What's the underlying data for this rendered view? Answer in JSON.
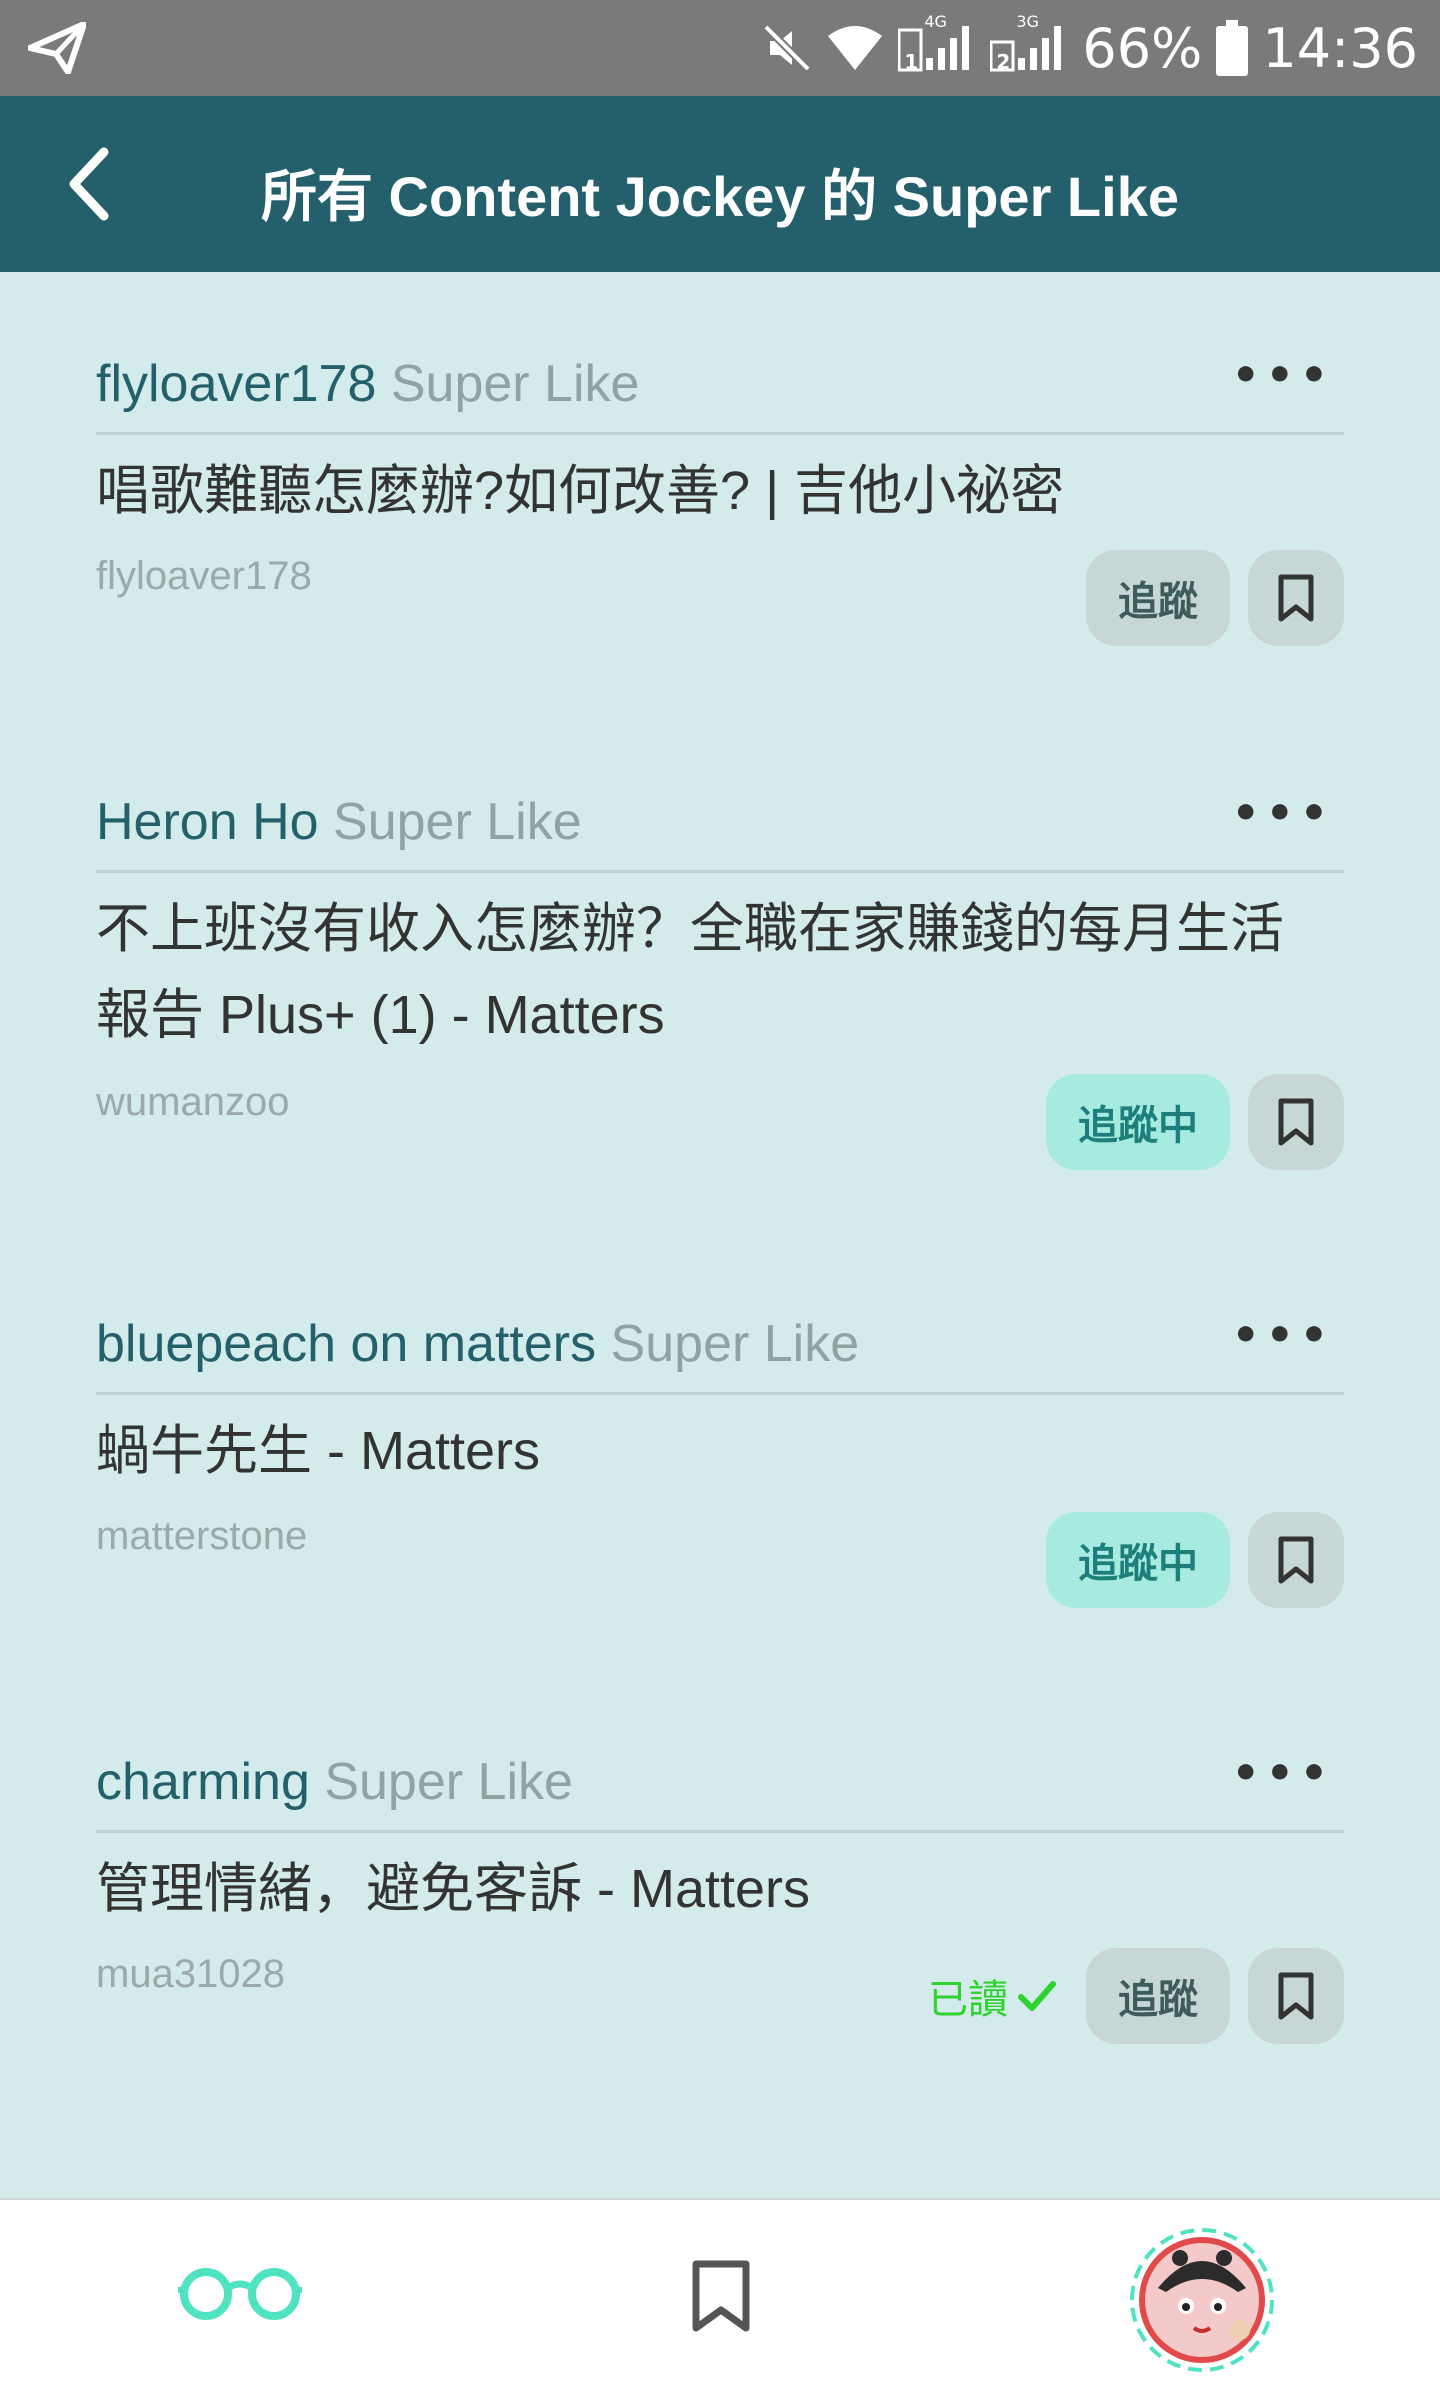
{
  "status_bar": {
    "network_4g": "4G",
    "network_3g": "3G",
    "sim1": "1",
    "sim2": "2",
    "battery": "66%",
    "time": "14:36",
    "icons": [
      "send-icon",
      "mute-icon",
      "wifi-icon",
      "signal-icon",
      "battery-icon"
    ]
  },
  "app_bar": {
    "title": "所有 Content Jockey 的 Super Like",
    "back_icon": "chevron-left-icon"
  },
  "feed": [
    {
      "liker": "flyloaver178",
      "liked_label": "Super Like",
      "article_title": "唱歌難聽怎麼辦?如何改善? | 吉他小祕密",
      "author": "flyloaver178",
      "follow_label": "追蹤",
      "following": false,
      "read_label": ""
    },
    {
      "liker": "Heron Ho",
      "liked_label": "Super Like",
      "article_title": "不上班沒有收入怎麼辦？全職在家賺錢的每月生活報告 Plus+ (1) - Matters",
      "author": "wumanzoo",
      "follow_label": "追蹤中",
      "following": true,
      "read_label": ""
    },
    {
      "liker": "bluepeach on matters",
      "liked_label": "Super Like",
      "article_title": "蝸牛先生 - Matters",
      "author": "matterstone",
      "follow_label": "追蹤中",
      "following": true,
      "read_label": ""
    },
    {
      "liker": "charming",
      "liked_label": "Super Like",
      "article_title": "管理情緒，避免客訴 - Matters",
      "author": "mua31028",
      "follow_label": "追蹤",
      "following": false,
      "read_label": "已讀"
    }
  ],
  "colors": {
    "app_bar": "#24606b",
    "background": "#d3ebea",
    "liker_name": "#24606b",
    "following_bg": "#a7ebe0",
    "read_green": "#2fd32f",
    "accent": "#50e3c2"
  },
  "bottom_nav": {
    "items": [
      "reading-glasses-icon",
      "bookmark-icon",
      "avatar"
    ]
  }
}
